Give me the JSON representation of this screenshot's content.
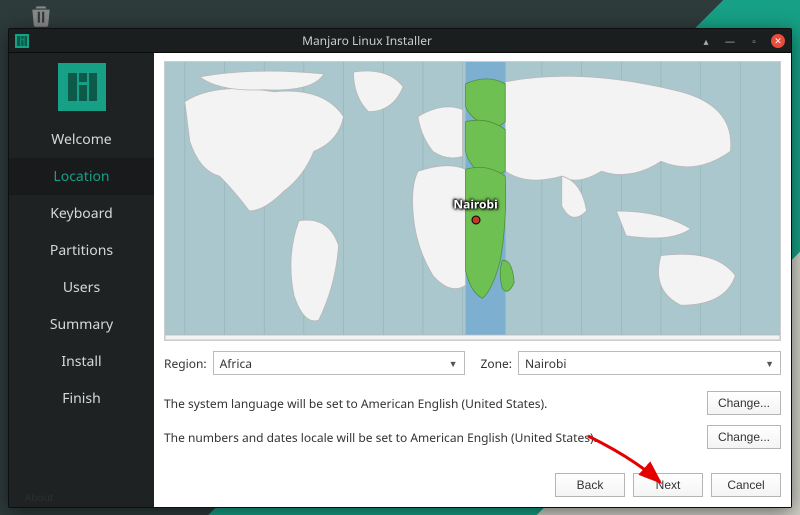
{
  "window": {
    "title": "Manjaro Linux Installer"
  },
  "sidebar": {
    "items": [
      {
        "label": "Welcome"
      },
      {
        "label": "Location"
      },
      {
        "label": "Keyboard"
      },
      {
        "label": "Partitions"
      },
      {
        "label": "Users"
      },
      {
        "label": "Summary"
      },
      {
        "label": "Install"
      },
      {
        "label": "Finish"
      }
    ],
    "active_index": 1,
    "about_label": "About"
  },
  "location": {
    "region_label": "Region:",
    "region_value": "Africa",
    "zone_label": "Zone:",
    "zone_value": "Nairobi",
    "pin_city": "Nairobi",
    "language_text": "The system language will be set to American English (United States).",
    "numbers_text": "The numbers and dates locale will be set to American English (United States).",
    "change_label": "Change..."
  },
  "buttons": {
    "back": "Back",
    "next": "Next",
    "cancel": "Cancel"
  },
  "colors": {
    "accent": "#16a085",
    "highlight_land": "#6fc053",
    "land": "#efefef",
    "sea": "#a9c7cc",
    "tz_band": "#5a9bd4"
  }
}
